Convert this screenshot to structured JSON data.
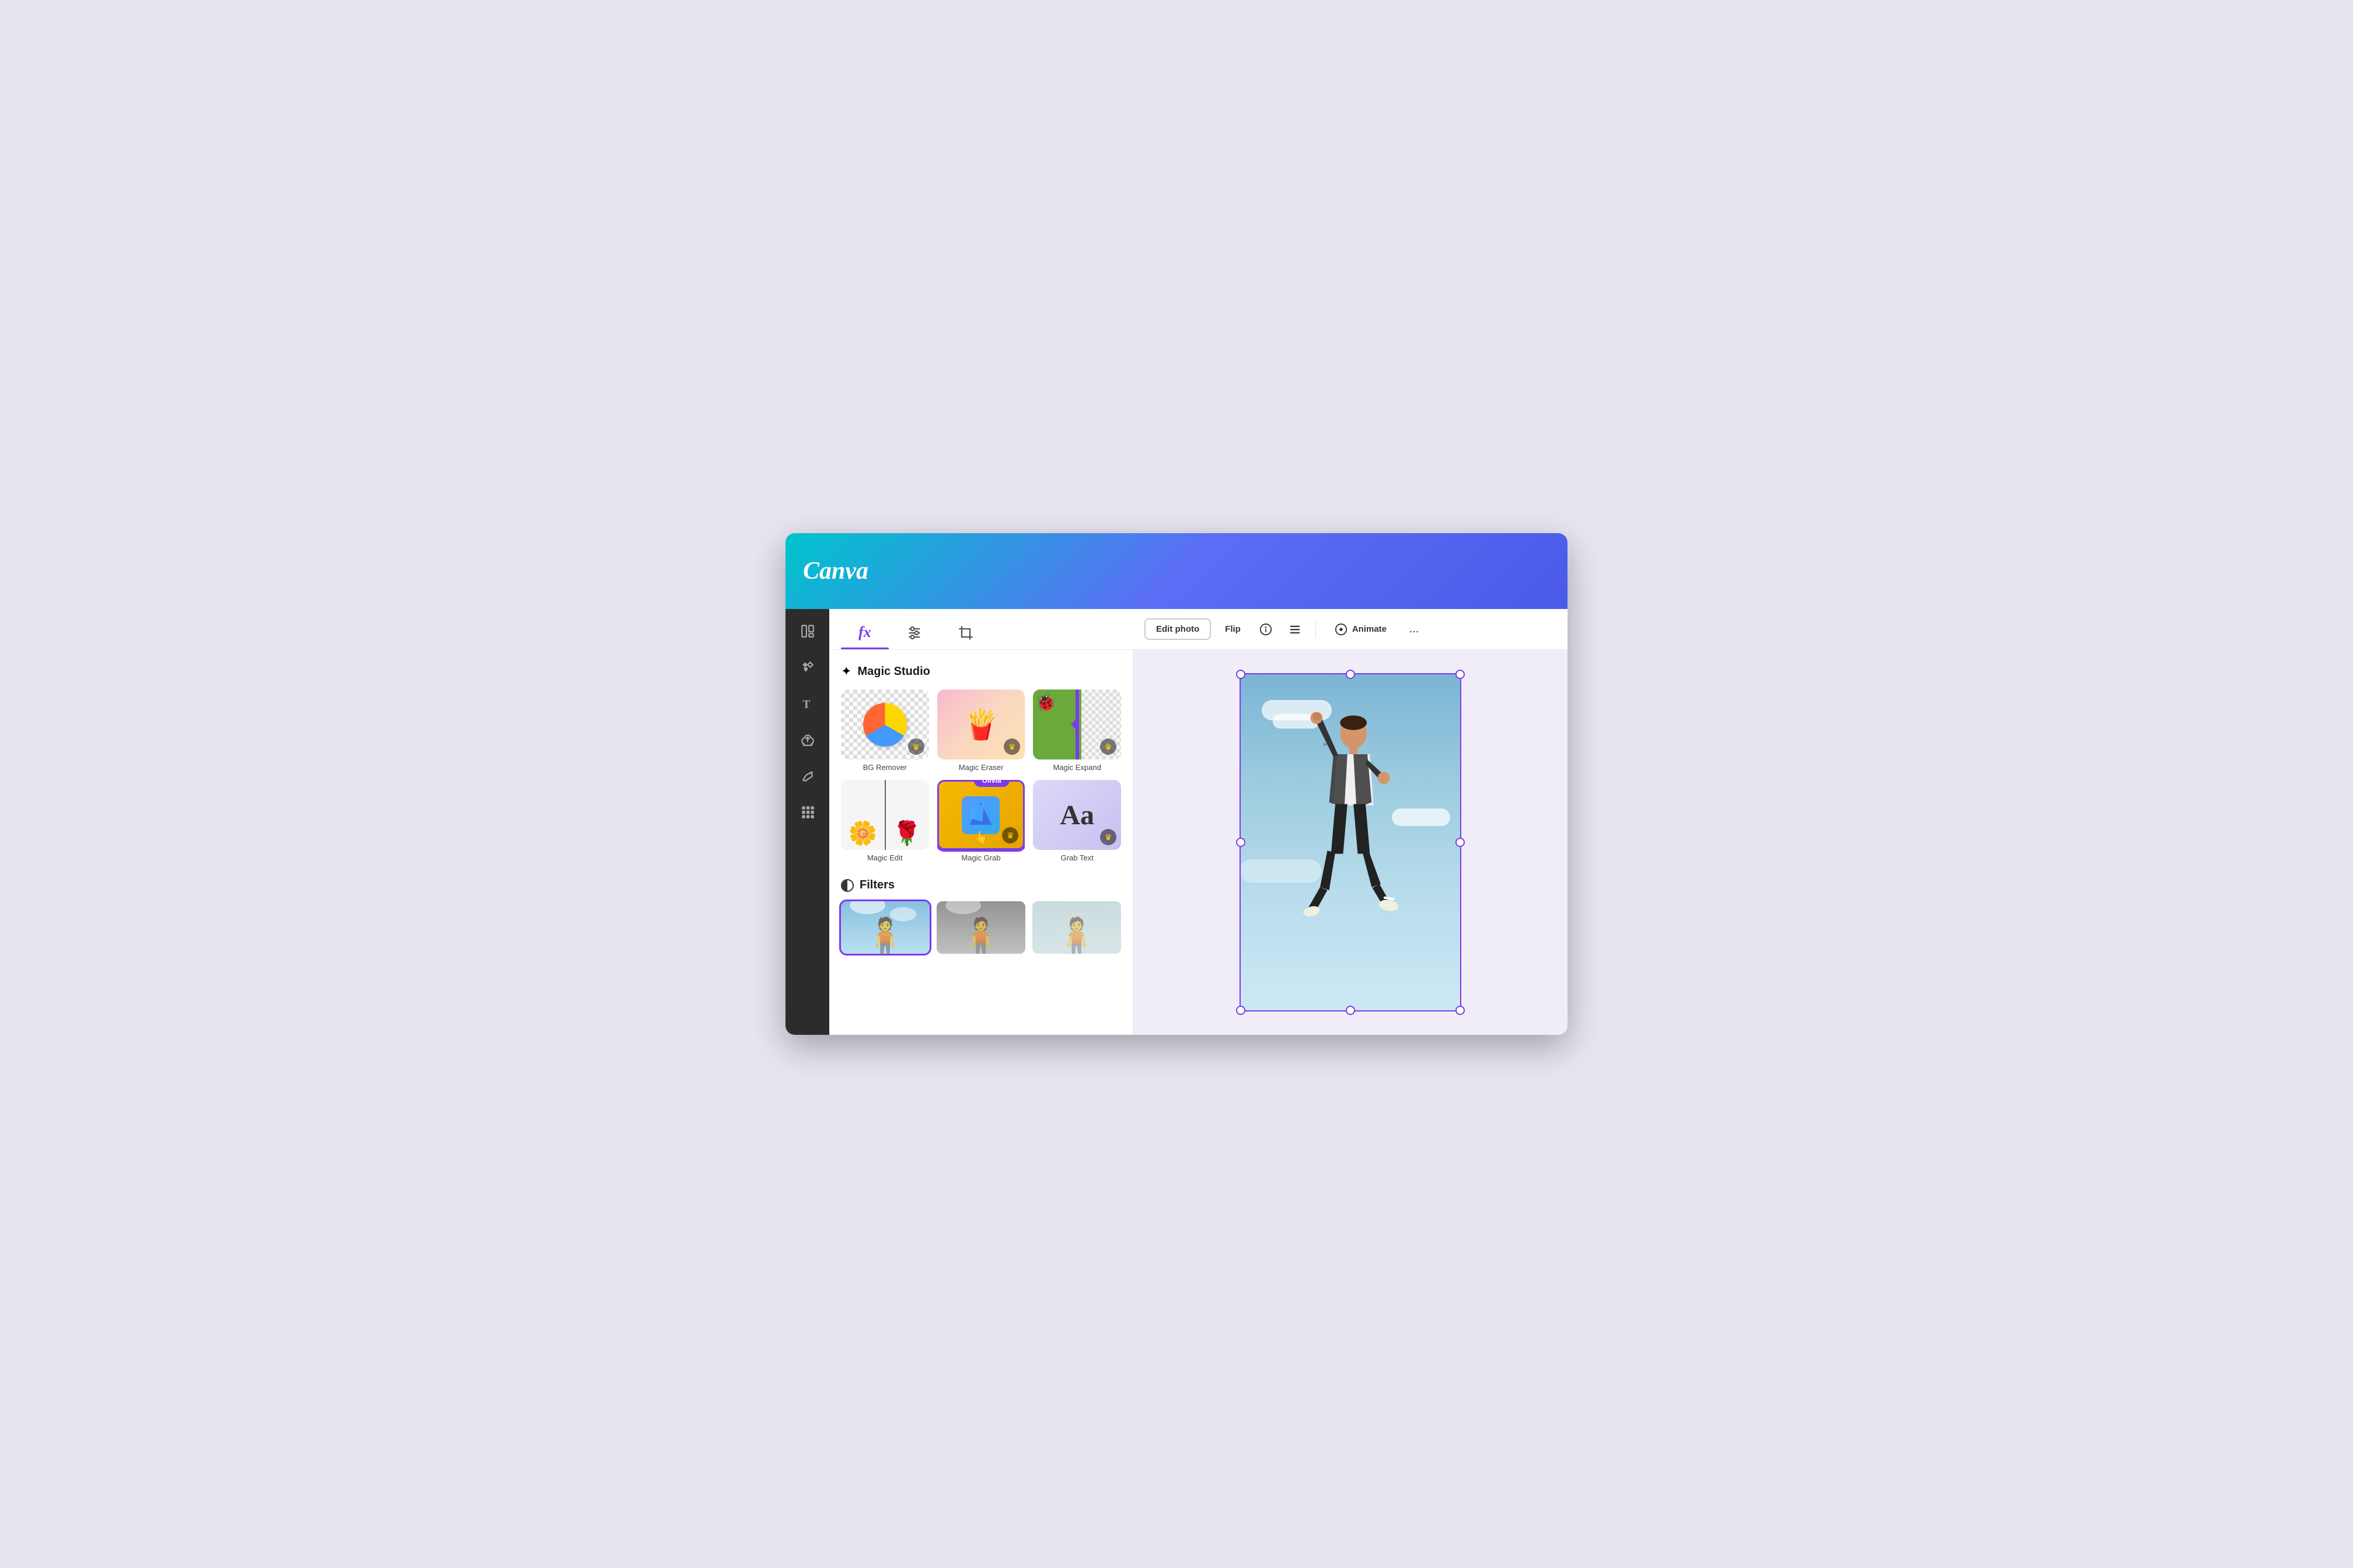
{
  "app": {
    "name": "Canva",
    "window_bg": "#e8e4f0"
  },
  "header": {
    "logo": "Canva",
    "gradient_start": "#00c4cc",
    "gradient_end": "#4a5ae8"
  },
  "sidebar": {
    "items": [
      {
        "id": "layout",
        "icon": "layout-icon",
        "label": "Layout"
      },
      {
        "id": "elements",
        "icon": "elements-icon",
        "label": "Elements"
      },
      {
        "id": "text",
        "icon": "text-icon",
        "label": "Text"
      },
      {
        "id": "upload",
        "icon": "upload-icon",
        "label": "Uploads"
      },
      {
        "id": "draw",
        "icon": "draw-icon",
        "label": "Draw"
      },
      {
        "id": "apps",
        "icon": "apps-icon",
        "label": "Apps"
      }
    ]
  },
  "tools_panel": {
    "tabs": [
      {
        "id": "effects",
        "label": "fx",
        "active": true
      },
      {
        "id": "adjust",
        "label": "adjust",
        "active": false
      },
      {
        "id": "crop",
        "label": "crop",
        "active": false
      }
    ],
    "magic_studio": {
      "title": "Magic Studio",
      "features": [
        {
          "id": "bg-remover",
          "label": "BG Remover",
          "has_crown": true,
          "selected": false
        },
        {
          "id": "magic-eraser",
          "label": "Magic Eraser",
          "has_crown": true,
          "selected": false
        },
        {
          "id": "magic-expand",
          "label": "Magic Expand",
          "has_crown": true,
          "selected": false
        },
        {
          "id": "magic-edit",
          "label": "Magic Edit",
          "has_crown": false,
          "selected": false
        },
        {
          "id": "magic-grab",
          "label": "Magic Grab",
          "has_crown": true,
          "selected": true,
          "badge": "Olivia"
        },
        {
          "id": "grab-text",
          "label": "Grab Text",
          "has_crown": true,
          "selected": false
        }
      ]
    },
    "filters": {
      "title": "Filters",
      "items": [
        {
          "id": "filter-original",
          "label": "Original",
          "selected": true
        },
        {
          "id": "filter-mono",
          "label": "Mono",
          "selected": false
        },
        {
          "id": "filter-fade",
          "label": "Fade",
          "selected": false
        }
      ]
    }
  },
  "canvas_toolbar": {
    "edit_photo": "Edit photo",
    "flip": "Flip",
    "info_icon": "ℹ",
    "list_icon": "≡",
    "animate": "Animate",
    "more": "..."
  },
  "canvas": {
    "photo_subject": "Jumping man",
    "selection_color": "#7c3aed"
  },
  "colors": {
    "accent": "#7c3aed",
    "accent_light": "#9d5cf0",
    "dark_bg": "#2c2c2c",
    "header_from": "#00c4cc",
    "header_to": "#4a5ae8"
  }
}
